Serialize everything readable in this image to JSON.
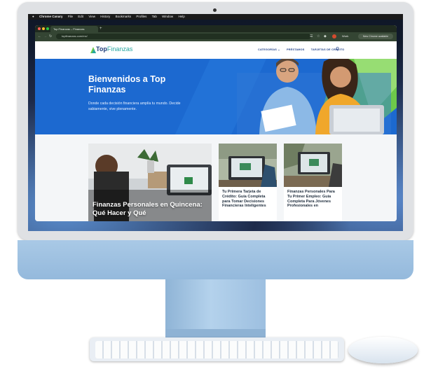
{
  "macos_menubar": {
    "app_name": "Chrome Canary",
    "items": [
      "File",
      "Edit",
      "View",
      "History",
      "Bookmarks",
      "Profiles",
      "Tab",
      "Window",
      "Help"
    ]
  },
  "browser": {
    "tab_title": "Top Finanzas – Finanzas",
    "url": "topfinanzas.com/mx/",
    "profile_label": "Work",
    "update_label": "New Chrome available"
  },
  "site": {
    "logo": {
      "part1": "Top",
      "part2": "Finanzas"
    },
    "nav": [
      "CATEGORÍAS ⌄",
      "PRÉSTAMOS",
      "TARJETAS DE CRÉDITO"
    ],
    "hero": {
      "title": "Bienvenidos a Top Finanzas",
      "subtitle": "Donde cada decisión financiera amplía tu mundo. Decide sabiamente, vive plenamente."
    },
    "cards": [
      {
        "title": "Finanzas Personales en Quincena: Qué Hacer y Qué"
      },
      {
        "title": "Tu Primera Tarjeta de Crédito: Guía Completa para Tomar Decisiones Financieras Inteligentes"
      },
      {
        "title": "Finanzas Personales Para Tu Primer Empleo: Guía Completa Para Jóvenes Profesionales en"
      }
    ]
  },
  "colors": {
    "hero_blue": "#1c69d0",
    "brand_navy": "#1d3c7a",
    "brand_teal": "#26a6a0",
    "accent_green": "#6dc94a",
    "imac_blue": "#a9c9e6"
  }
}
